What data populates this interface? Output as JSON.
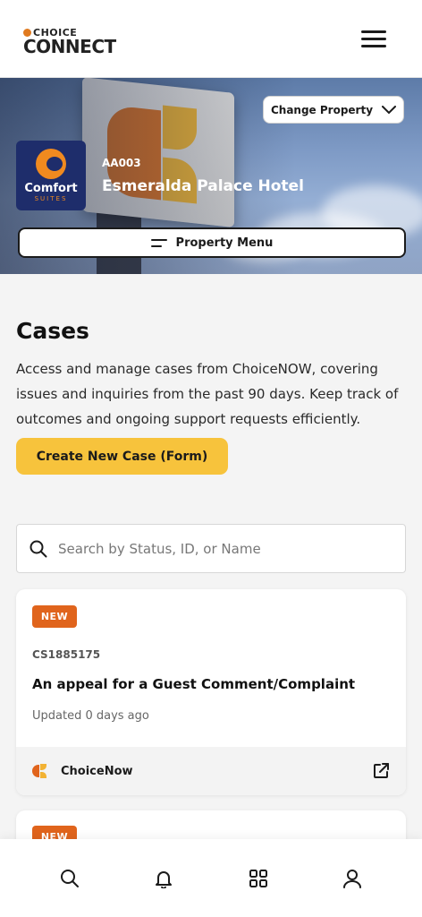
{
  "header": {
    "logo_top": "CHOICE",
    "logo_main": "CONNECT",
    "menu_icon": "hamburger-menu-icon"
  },
  "property": {
    "brand_name": "Comfort",
    "brand_sub": "SUITES",
    "code": "AA003",
    "name": "Esmeralda Palace Hotel",
    "change_label": "Change Property",
    "menu_label": "Property Menu"
  },
  "cases": {
    "title": "Cases",
    "description": "Access and manage cases from ChoiceNOW, covering issues and inquiries from the past 90 days. Keep track of outcomes and ongoing support requests efficiently.",
    "create_label": "Create New Case (Form)",
    "search_placeholder": "Search by Status, ID, or Name",
    "items": [
      {
        "status": "NEW",
        "id": "CS1885175",
        "title": "An appeal for a Guest Comment/Complaint",
        "updated": "Updated 0 days ago",
        "source": "ChoiceNow"
      },
      {
        "status": "NEW"
      }
    ]
  },
  "bottom_nav": [
    "search-icon",
    "bell-icon",
    "grid-icon",
    "user-icon"
  ],
  "colors": {
    "accent_yellow": "#f7c33c",
    "badge_orange": "#e0641c",
    "brand_navy": "#1e2d6b"
  }
}
